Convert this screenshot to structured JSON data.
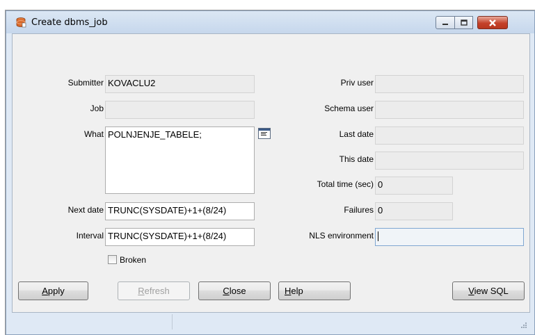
{
  "window": {
    "title": "Create dbms_job"
  },
  "icons": {
    "app": "database-icon",
    "minimize": "minimize-icon",
    "maximize": "maximize-icon",
    "close": "close-icon",
    "what_editor": "text-editor-icon",
    "grip": "resize-grip-icon"
  },
  "left": {
    "submitter": {
      "label": "Submitter",
      "value": "KOVACLU2"
    },
    "job": {
      "label": "Job",
      "value": ""
    },
    "what": {
      "label": "What",
      "value": "POLNJENJE_TABELE;"
    },
    "next_date": {
      "label": "Next date",
      "value": "TRUNC(SYSDATE)+1+(8/24)"
    },
    "interval": {
      "label": "Interval",
      "value": "TRUNC(SYSDATE)+1+(8/24)"
    },
    "broken": {
      "label": "Broken",
      "checked": false
    }
  },
  "right": {
    "priv_user": {
      "label": "Priv user",
      "value": ""
    },
    "schema_user": {
      "label": "Schema user",
      "value": ""
    },
    "last_date": {
      "label": "Last date",
      "value": ""
    },
    "this_date": {
      "label": "This date",
      "value": ""
    },
    "total_time": {
      "label": "Total time (sec)",
      "value": "0"
    },
    "failures": {
      "label": "Failures",
      "value": "0"
    },
    "nls_env": {
      "label": "NLS environment",
      "value": ""
    }
  },
  "buttons": {
    "apply": {
      "mnemonic": "A",
      "rest": "pply"
    },
    "refresh": {
      "mnemonic": "R",
      "rest": "efresh"
    },
    "close": {
      "mnemonic": "C",
      "rest": "lose"
    },
    "help": {
      "mnemonic": "H",
      "rest": "elp"
    },
    "view_sql": {
      "mnemonic": "V",
      "rest": "iew SQL"
    }
  },
  "colors": {
    "window_frame": "#dfe9f5",
    "client_bg": "#f0f0f0",
    "close_button": "#c4412a"
  }
}
